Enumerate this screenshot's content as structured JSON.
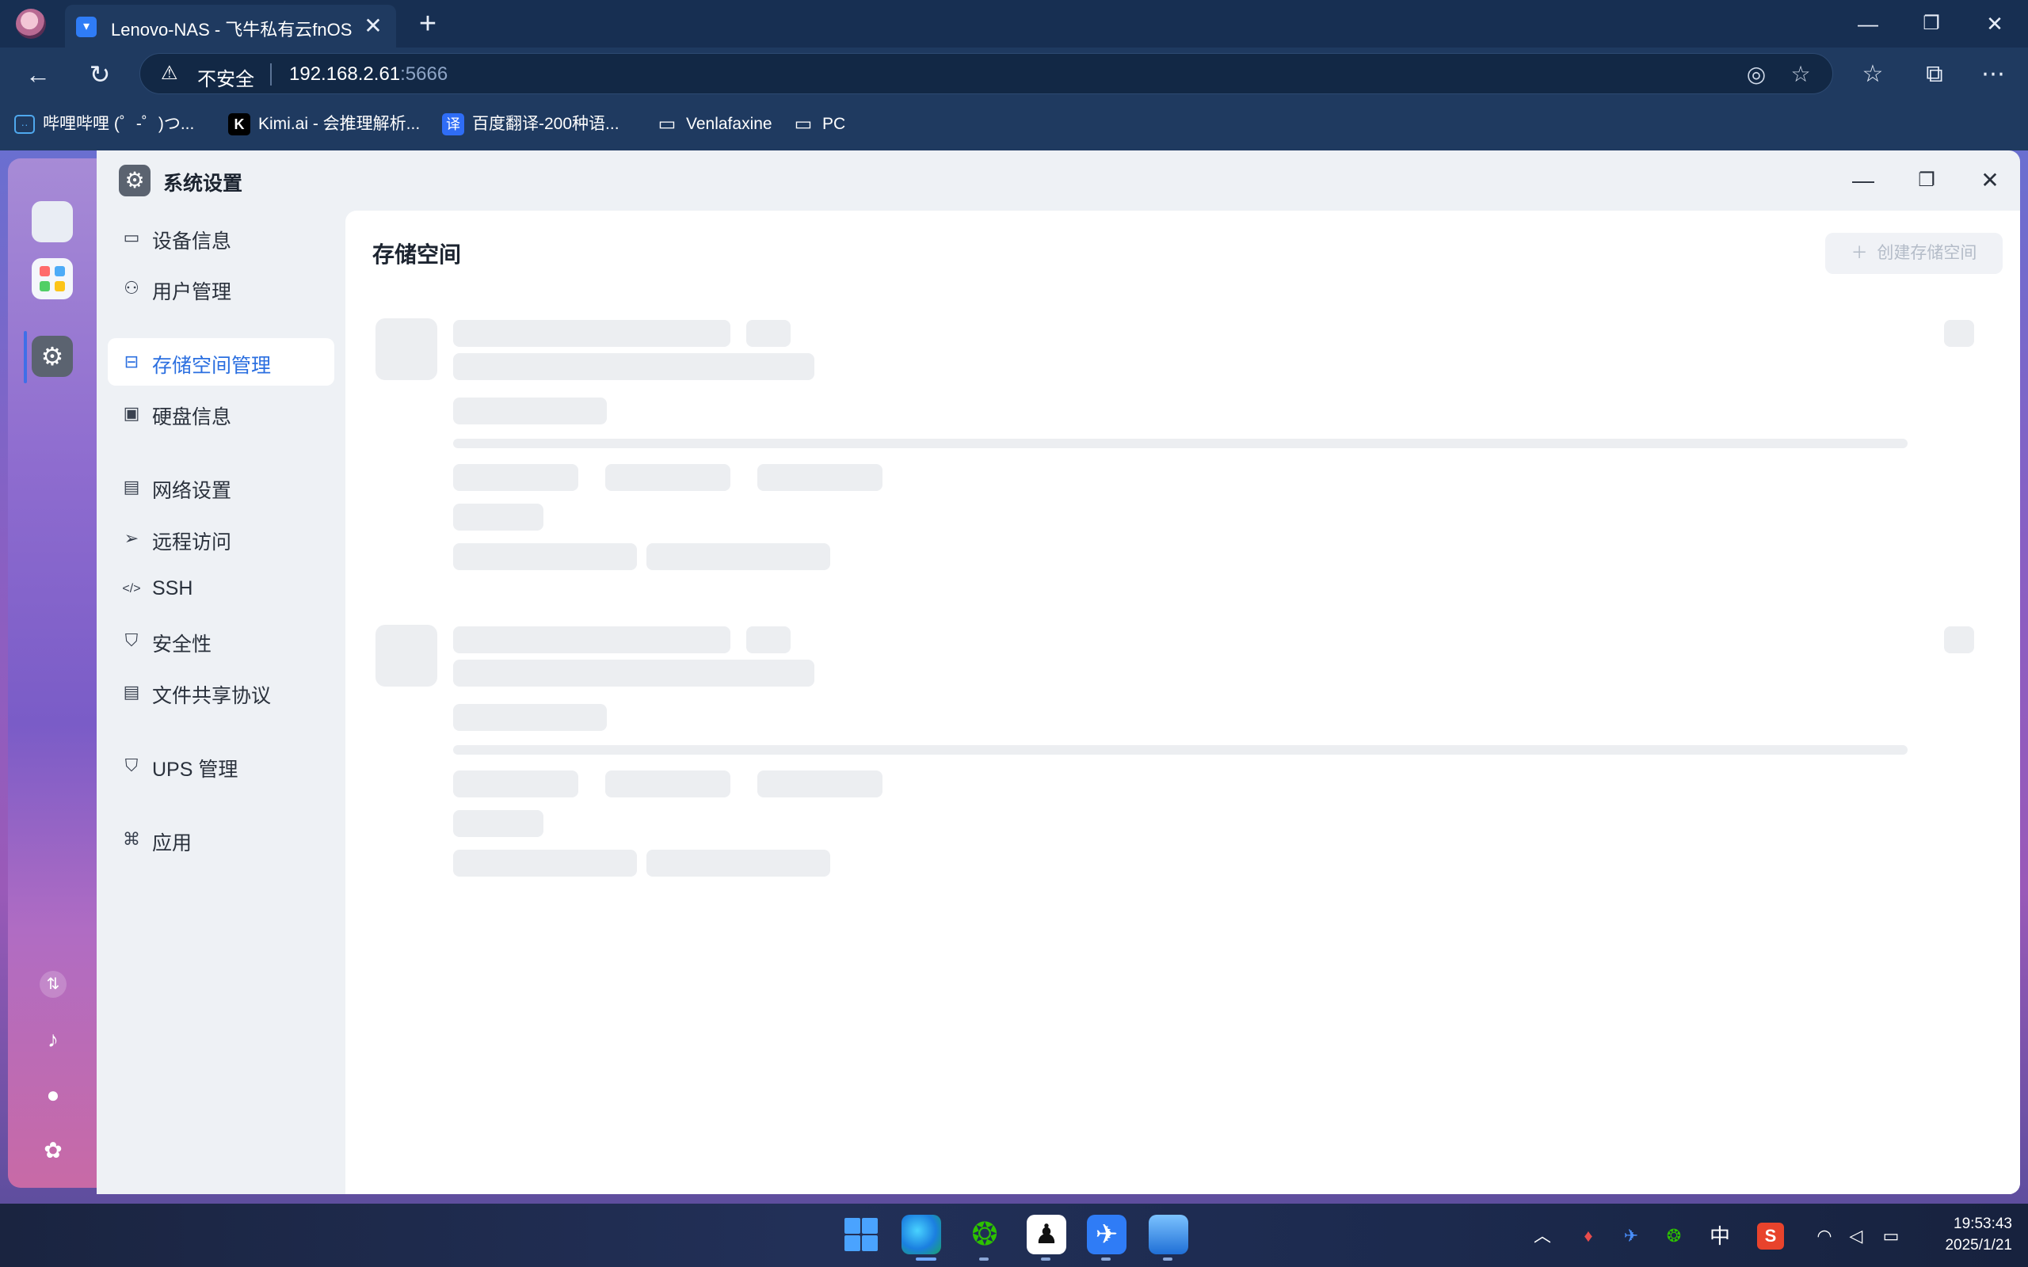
{
  "browser": {
    "tab_title": "Lenovo-NAS - 飞牛私有云fnOS",
    "tab_close": "✕",
    "new_tab": "+",
    "security_label": "不安全",
    "url_host": "192.168.2.61",
    "url_port": ":5666",
    "bookmarks": [
      {
        "label": "哔哩哔哩 (゜-゜)つ...",
        "icon": "bilibili-icon"
      },
      {
        "label": "Kimi.ai - 会推理解析...",
        "icon": "kimi-icon"
      },
      {
        "label": "百度翻译-200种语...",
        "icon": "baidu-translate-icon"
      },
      {
        "label": "Venlafaxine",
        "icon": "folder-icon"
      },
      {
        "label": "PC",
        "icon": "folder-icon"
      }
    ]
  },
  "window": {
    "title": "系统设置",
    "nav": [
      {
        "label": "设备信息",
        "icon": "device-icon"
      },
      {
        "label": "用户管理",
        "icon": "user-icon"
      },
      {
        "label": "存储空间管理",
        "icon": "storage-icon",
        "active": true
      },
      {
        "label": "硬盘信息",
        "icon": "disk-icon"
      },
      {
        "label": "网络设置",
        "icon": "network-icon"
      },
      {
        "label": "远程访问",
        "icon": "send-icon"
      },
      {
        "label": "SSH",
        "icon": "code-icon"
      },
      {
        "label": "安全性",
        "icon": "shield-check-icon"
      },
      {
        "label": "文件共享协议",
        "icon": "document-icon"
      },
      {
        "label": "UPS 管理",
        "icon": "shield-icon"
      },
      {
        "label": "应用",
        "icon": "apps-icon"
      }
    ],
    "content": {
      "title": "存储空间",
      "create_button": "创建存储空间"
    }
  },
  "taskbar": {
    "input_method": "中",
    "time": "19:53:43",
    "date": "2025/1/21"
  },
  "colors": {
    "accent": "#2b6fe0",
    "browser_chrome": "#1f3a60",
    "skeleton": "#eceef1"
  }
}
